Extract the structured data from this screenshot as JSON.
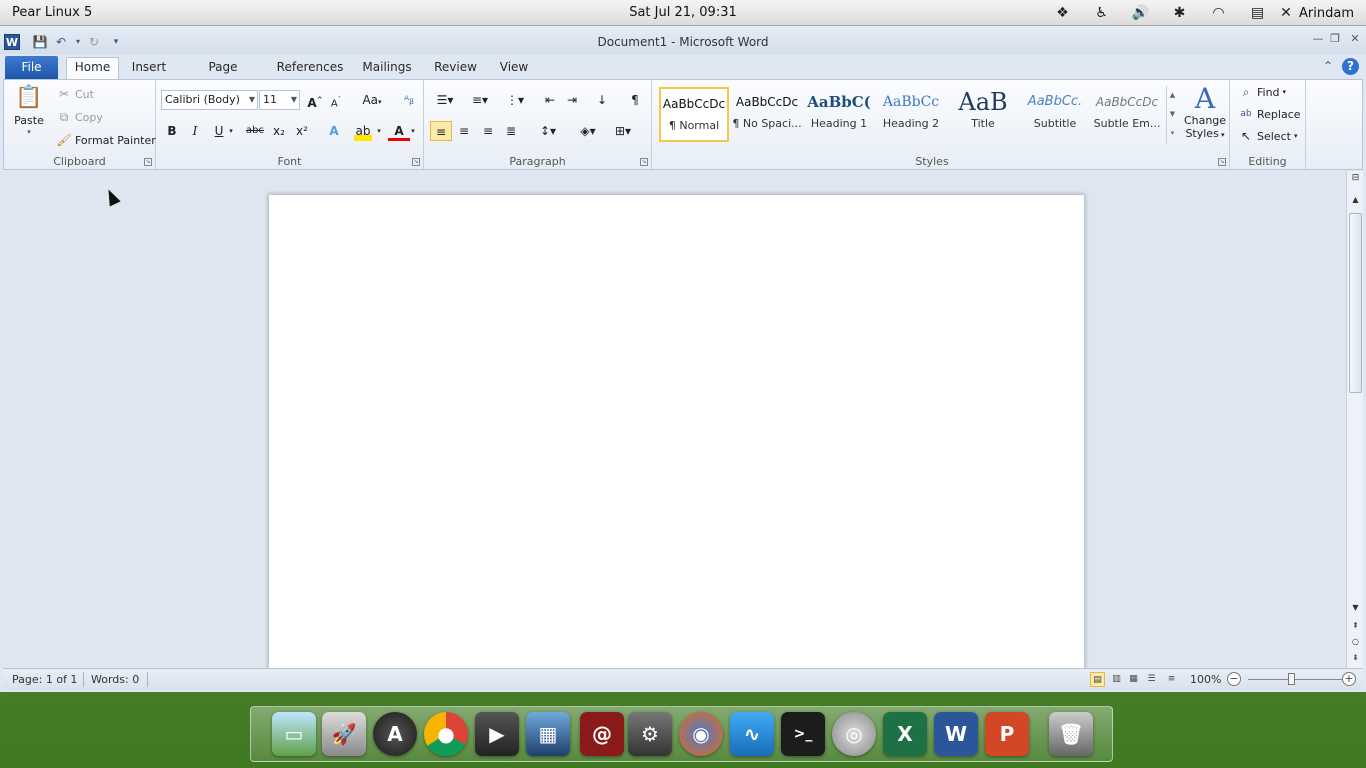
{
  "topbar": {
    "distro": "Pear Linux 5",
    "clock": "Sat Jul 21, 09:31",
    "user": "Arindam",
    "tray_icons": [
      "dropbox-icon",
      "accessibility-icon",
      "volume-icon",
      "bluetooth-icon",
      "wifi-icon",
      "clipboard-icon",
      "user-icon"
    ]
  },
  "window": {
    "title": "Document1 - Microsoft Word"
  },
  "tabs": {
    "file": "File",
    "home": "Home",
    "insert": "Insert",
    "page_layout": "Page Layout",
    "references": "References",
    "mailings": "Mailings",
    "review": "Review",
    "view": "View"
  },
  "ribbon": {
    "clipboard": {
      "label": "Clipboard",
      "paste": "Paste",
      "cut": "Cut",
      "copy": "Copy",
      "format_painter": "Format Painter"
    },
    "font": {
      "label": "Font",
      "family": "Calibri (Body)",
      "size": "11",
      "change_case": "Aa",
      "bold": "B",
      "italic": "I",
      "underline": "U",
      "strike": "abc",
      "sub": "x₂",
      "sup": "x²"
    },
    "paragraph": {
      "label": "Paragraph",
      "show_marks": "¶"
    },
    "styles": {
      "label": "Styles",
      "items": [
        {
          "sample": "AaBbCcDc",
          "name": "¶ Normal"
        },
        {
          "sample": "AaBbCcDc",
          "name": "¶ No Spaci..."
        },
        {
          "sample": "AaBbC(",
          "name": "Heading 1"
        },
        {
          "sample": "AaBbCc",
          "name": "Heading 2"
        },
        {
          "sample": "AaB",
          "name": "Title"
        },
        {
          "sample": "AaBbCc.",
          "name": "Subtitle"
        },
        {
          "sample": "AaBbCcDc",
          "name": "Subtle Em..."
        }
      ],
      "change_styles_1": "Change",
      "change_styles_2": "Styles"
    },
    "editing": {
      "label": "Editing",
      "find": "Find",
      "replace": "Replace",
      "select": "Select"
    }
  },
  "status": {
    "page": "Page: 1 of 1",
    "words": "Words: 0",
    "zoom": "100%"
  },
  "dock": {
    "apps": [
      "desktop",
      "launchpad",
      "app-store",
      "chrome",
      "video",
      "photos",
      "mail",
      "settings",
      "firefox",
      "activity-monitor",
      "terminal",
      "disk-utility",
      "excel",
      "word",
      "powerpoint",
      "trash"
    ],
    "labels": {
      "mail": "@",
      "terminal": ">_",
      "excel": "X",
      "word": "W",
      "powerpoint": "P"
    }
  },
  "colors": {
    "file_tab": "#1f56a8",
    "ribbon_bg": "#e8eef6",
    "selected_style_border": "#f2c94c",
    "dock_excel": "#1e7145",
    "dock_word": "#2b579a",
    "dock_powerpoint": "#d24726"
  }
}
